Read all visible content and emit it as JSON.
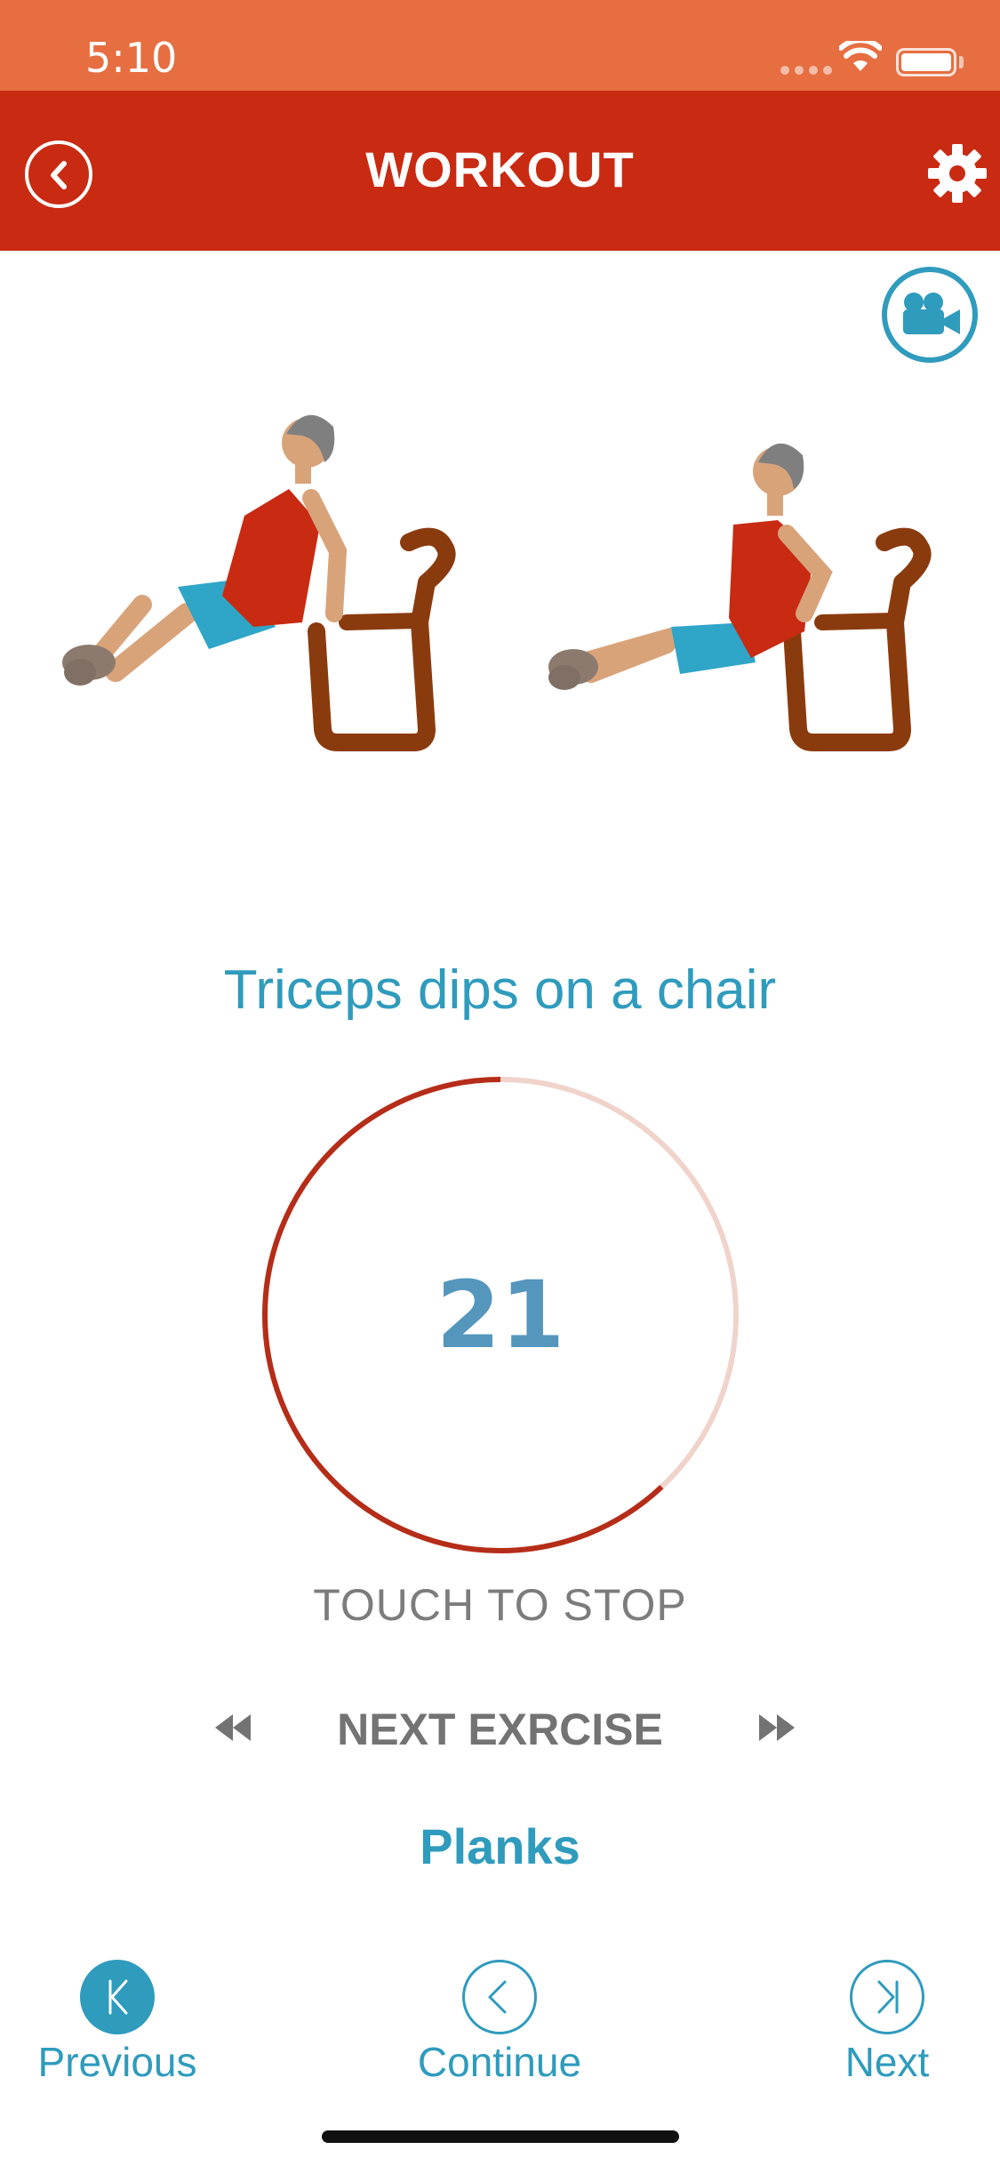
{
  "status_bar": {
    "time": "5:10"
  },
  "header": {
    "title": "WORKOUT",
    "back_icon": "chevron-left-icon",
    "settings_icon": "gear-icon"
  },
  "video": {
    "icon": "video-camera-icon"
  },
  "exercise": {
    "name": "Triceps dips on a chair"
  },
  "timer": {
    "value": "21",
    "progress_fraction": 0.62
  },
  "controls": {
    "touch_label": "TOUCH TO STOP",
    "next_heading": "NEXT EXRCISE",
    "next_exercise": "Planks"
  },
  "bottom_nav": {
    "previous_label": "Previous",
    "continue_label": "Continue",
    "next_label": "Next"
  },
  "colors": {
    "status_bar": "#e66e41",
    "header": "#c92a12",
    "accent": "#2f9bbd",
    "timer_progress": "#b52d18",
    "timer_track": "#f0d3cb"
  }
}
